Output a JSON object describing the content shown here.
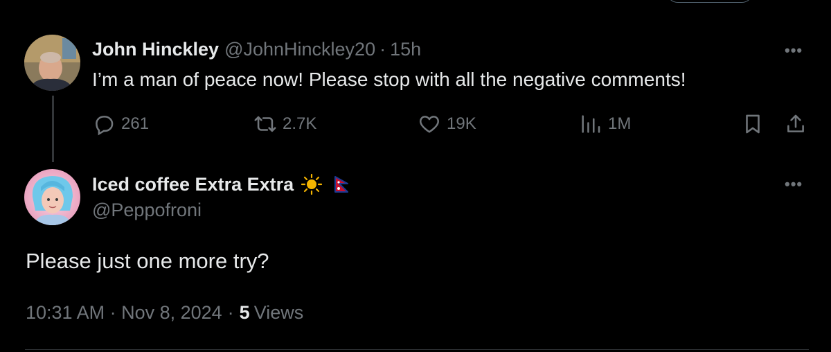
{
  "parent_tweet": {
    "display_name": "John Hinckley",
    "handle": "@JohnHinckley20",
    "separator": "·",
    "time": "15h",
    "text": "I’m a man of peace now! Please stop with all the negative comments!",
    "more_label": "•••",
    "actions": {
      "replies": "261",
      "reposts": "2.7K",
      "likes": "19K",
      "views": "1M"
    }
  },
  "reply_tweet": {
    "display_name": "Iced coffee Extra Extra",
    "handle": "@Peppofroni",
    "more_label": "•••",
    "text": "Please just one more try?",
    "timestamp": "10:31 AM · Nov 8, 2024",
    "separator": "·",
    "views_count": "5",
    "views_label": "Views"
  },
  "colors": {
    "background": "#000000",
    "text": "#e7e9ea",
    "muted": "#71767b",
    "thread_line": "#333639",
    "sun": "#f4b400"
  },
  "icons": [
    "reply-icon",
    "repost-icon",
    "like-icon",
    "views-icon",
    "bookmark-icon",
    "share-icon",
    "sun-emoji-icon",
    "nepal-flag-icon"
  ]
}
